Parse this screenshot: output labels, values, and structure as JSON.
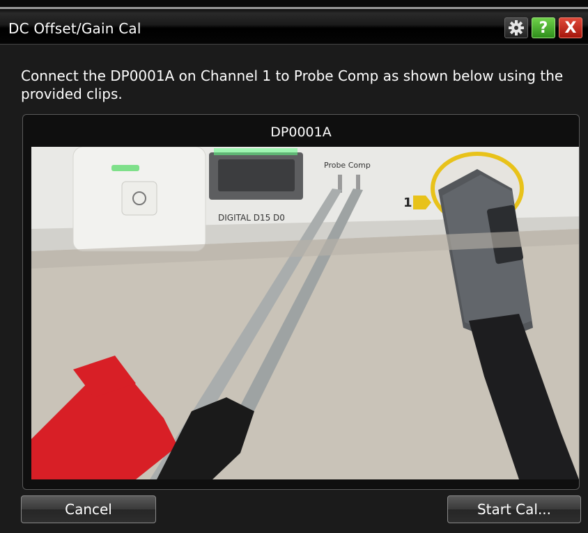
{
  "window": {
    "title": "DC Offset/Gain Cal",
    "buttons": {
      "help_label": "?",
      "close_label": "X"
    },
    "icons": [
      "gear-icon",
      "help-icon",
      "close-icon"
    ]
  },
  "instruction": "Connect the DP0001A on Channel 1 to Probe Comp as shown below using the provided clips.",
  "panel": {
    "title": "DP0001A",
    "photo_labels": {
      "probe_comp": "Probe Comp",
      "digital": "DIGITAL D15 D0",
      "channel": "1"
    }
  },
  "footer": {
    "cancel_label": "Cancel",
    "start_label": "Start Cal..."
  },
  "colors": {
    "title_bar": "#000000",
    "background": "#1b1b1b",
    "help_green": "#3fae26",
    "close_red": "#c0281a",
    "probe_yellow": "#e8c21a",
    "clip_red": "#d81f26"
  }
}
